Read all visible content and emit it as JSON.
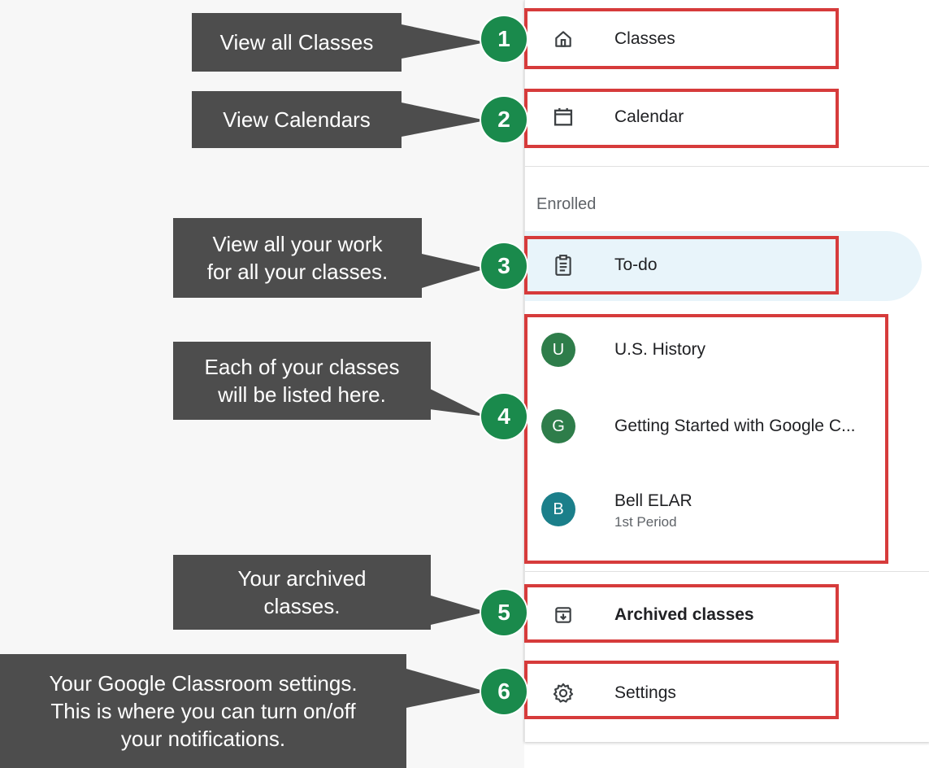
{
  "nav": {
    "classes": {
      "label": "Classes",
      "icon": "home-icon"
    },
    "calendar": {
      "label": "Calendar",
      "icon": "calendar-icon"
    },
    "section_enrolled": "Enrolled",
    "todo": {
      "label": "To-do",
      "icon": "clipboard-icon"
    },
    "classes_list": [
      {
        "initial": "U",
        "name": "U.S. History",
        "sub": "",
        "color": "#2e7d4a"
      },
      {
        "initial": "G",
        "name": "Getting Started with Google C...",
        "sub": "",
        "color": "#2e7d4a"
      },
      {
        "initial": "B",
        "name": "Bell ELAR",
        "sub": "1st Period",
        "color": "#1b7f8a"
      }
    ],
    "archived": {
      "label": "Archived classes",
      "icon": "archive-icon"
    },
    "settings": {
      "label": "Settings",
      "icon": "gear-icon"
    }
  },
  "callouts": [
    {
      "num": "1",
      "text": "View all Classes"
    },
    {
      "num": "2",
      "text": "View Calendars"
    },
    {
      "num": "3",
      "text": "View all your work\nfor all  your classes."
    },
    {
      "num": "4",
      "text": "Each of your classes\nwill be listed here."
    },
    {
      "num": "5",
      "text": "Your archived\nclasses."
    },
    {
      "num": "6",
      "text": "Your Google Classroom settings.\nThis is where you can turn on/off\nyour notifications."
    }
  ],
  "colors": {
    "callout_bg": "#4d4d4d",
    "badge_green": "#1a8a4c",
    "box_red": "#d63b3b",
    "todo_highlight": "#e8f4fa"
  }
}
